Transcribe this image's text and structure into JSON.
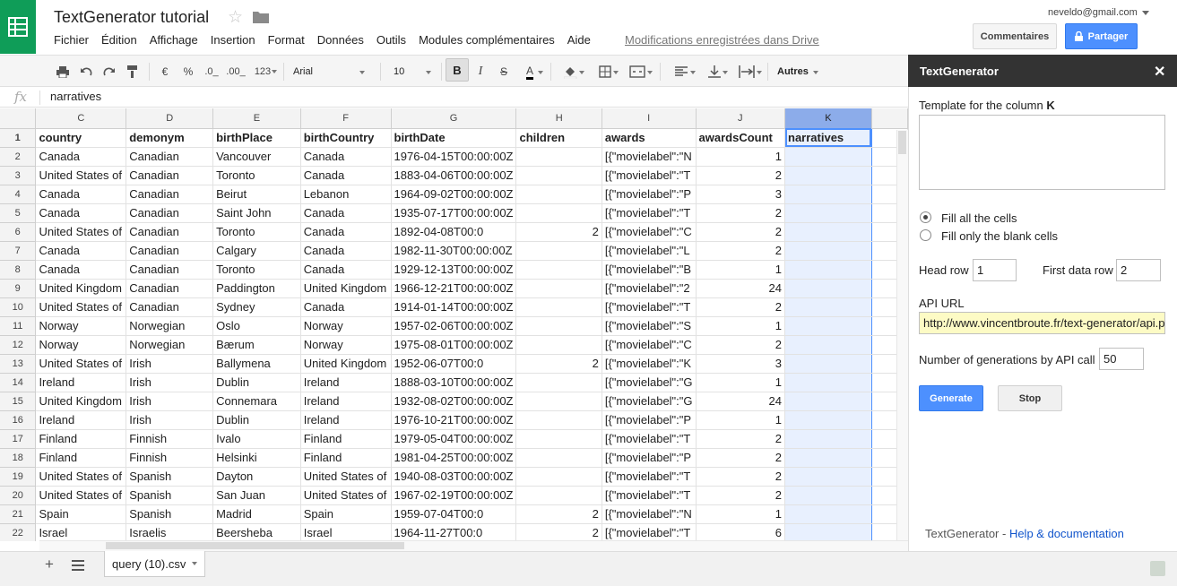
{
  "app": {
    "title": "TextGenerator tutorial",
    "menu": [
      "Fichier",
      "Édition",
      "Affichage",
      "Insertion",
      "Format",
      "Données",
      "Outils",
      "Modules complémentaires",
      "Aide"
    ],
    "saved_status": "Modifications enregistrées dans Drive",
    "user_email": "neveldo@gmail.com",
    "comments_label": "Commentaires",
    "share_label": "Partager",
    "brand_color": "#0f9d58",
    "accent_color": "#4d90fe"
  },
  "toolbar": {
    "currency": "€",
    "percent": "%",
    "dec_less": ".0_",
    "dec_more": ".00_",
    "number_format": "123",
    "font": "Arial",
    "font_size": "10",
    "bold": "B",
    "italic": "I",
    "strike": "S",
    "text_color": "A",
    "more": "Autres"
  },
  "formula_bar": {
    "fx": "fx",
    "value": "narratives"
  },
  "grid": {
    "columns": [
      "C",
      "D",
      "E",
      "F",
      "G",
      "H",
      "I",
      "J",
      "K"
    ],
    "rows": [
      {
        "n": "1",
        "cells": [
          "country",
          "demonym",
          "birthPlace",
          "birthCountry",
          "birthDate",
          "children",
          "awards",
          "awardsCount",
          "narratives"
        ]
      },
      {
        "n": "2",
        "cells": [
          "Canada",
          "Canadian",
          "Vancouver",
          "Canada",
          "1976-04-15T00:00:00Z",
          "",
          "[{\"movielabel\":\"N",
          "1",
          ""
        ]
      },
      {
        "n": "3",
        "cells": [
          "United States of",
          "Canadian",
          "Toronto",
          "Canada",
          "1883-04-06T00:00:00Z",
          "",
          "[{\"movielabel\":\"T",
          "2",
          ""
        ]
      },
      {
        "n": "4",
        "cells": [
          "Canada",
          "Canadian",
          "Beirut",
          "Lebanon",
          "1964-09-02T00:00:00Z",
          "",
          "[{\"movielabel\":\"P",
          "3",
          ""
        ]
      },
      {
        "n": "5",
        "cells": [
          "Canada",
          "Canadian",
          "Saint John",
          "Canada",
          "1935-07-17T00:00:00Z",
          "",
          "[{\"movielabel\":\"T",
          "2",
          ""
        ]
      },
      {
        "n": "6",
        "cells": [
          "United States of",
          "Canadian",
          "Toronto",
          "Canada",
          "1892-04-08T00:0",
          "2",
          "[{\"movielabel\":\"C",
          "2",
          ""
        ]
      },
      {
        "n": "7",
        "cells": [
          "Canada",
          "Canadian",
          "Calgary",
          "Canada",
          "1982-11-30T00:00:00Z",
          "",
          "[{\"movielabel\":\"L",
          "2",
          ""
        ]
      },
      {
        "n": "8",
        "cells": [
          "Canada",
          "Canadian",
          "Toronto",
          "Canada",
          "1929-12-13T00:00:00Z",
          "",
          "[{\"movielabel\":\"B",
          "1",
          ""
        ]
      },
      {
        "n": "9",
        "cells": [
          "United Kingdom",
          "Canadian",
          "Paddington",
          "United Kingdom",
          "1966-12-21T00:00:00Z",
          "",
          "[{\"movielabel\":\"2",
          "24",
          ""
        ]
      },
      {
        "n": "10",
        "cells": [
          "United States of",
          "Canadian",
          "Sydney",
          "Canada",
          "1914-01-14T00:00:00Z",
          "",
          "[{\"movielabel\":\"T",
          "2",
          ""
        ]
      },
      {
        "n": "11",
        "cells": [
          "Norway",
          "Norwegian",
          "Oslo",
          "Norway",
          "1957-02-06T00:00:00Z",
          "",
          "[{\"movielabel\":\"S",
          "1",
          ""
        ]
      },
      {
        "n": "12",
        "cells": [
          "Norway",
          "Norwegian",
          "Bærum",
          "Norway",
          "1975-08-01T00:00:00Z",
          "",
          "[{\"movielabel\":\"C",
          "2",
          ""
        ]
      },
      {
        "n": "13",
        "cells": [
          "United States of",
          "Irish",
          "Ballymena",
          "United Kingdom",
          "1952-06-07T00:0",
          "2",
          "[{\"movielabel\":\"K",
          "3",
          ""
        ]
      },
      {
        "n": "14",
        "cells": [
          "Ireland",
          "Irish",
          "Dublin",
          "Ireland",
          "1888-03-10T00:00:00Z",
          "",
          "[{\"movielabel\":\"G",
          "1",
          ""
        ]
      },
      {
        "n": "15",
        "cells": [
          "United Kingdom",
          "Irish",
          "Connemara",
          "Ireland",
          "1932-08-02T00:00:00Z",
          "",
          "[{\"movielabel\":\"G",
          "24",
          ""
        ]
      },
      {
        "n": "16",
        "cells": [
          "Ireland",
          "Irish",
          "Dublin",
          "Ireland",
          "1976-10-21T00:00:00Z",
          "",
          "[{\"movielabel\":\"P",
          "1",
          ""
        ]
      },
      {
        "n": "17",
        "cells": [
          "Finland",
          "Finnish",
          "Ivalo",
          "Finland",
          "1979-05-04T00:00:00Z",
          "",
          "[{\"movielabel\":\"T",
          "2",
          ""
        ]
      },
      {
        "n": "18",
        "cells": [
          "Finland",
          "Finnish",
          "Helsinki",
          "Finland",
          "1981-04-25T00:00:00Z",
          "",
          "[{\"movielabel\":\"P",
          "2",
          ""
        ]
      },
      {
        "n": "19",
        "cells": [
          "United States of",
          "Spanish",
          "Dayton",
          "United States of",
          "1940-08-03T00:00:00Z",
          "",
          "[{\"movielabel\":\"T",
          "2",
          ""
        ]
      },
      {
        "n": "20",
        "cells": [
          "United States of",
          "Spanish",
          "San Juan",
          "United States of",
          "1967-02-19T00:00:00Z",
          "",
          "[{\"movielabel\":\"T",
          "2",
          ""
        ]
      },
      {
        "n": "21",
        "cells": [
          "Spain",
          "Spanish",
          "Madrid",
          "Spain",
          "1959-07-04T00:0",
          "2",
          "[{\"movielabel\":\"N",
          "1",
          ""
        ]
      },
      {
        "n": "22",
        "cells": [
          "Israel",
          "Israelis",
          "Beersheba",
          "Israel",
          "1964-11-27T00:0",
          "2",
          "[{\"movielabel\":\"T",
          "6",
          ""
        ]
      }
    ]
  },
  "sheet": {
    "add": "+",
    "tab_name": "query (10).csv"
  },
  "sidebar": {
    "title": "TextGenerator",
    "close": "✕",
    "template_label": "Template for the column ",
    "template_column": "K",
    "template_value": "",
    "fill_all": "Fill all the cells",
    "fill_blank": "Fill only the blank cells",
    "fill_mode": "all",
    "head_row_label": "Head row",
    "head_row_value": "1",
    "first_data_row_label": "First data row",
    "first_data_row_value": "2",
    "api_url_label": "API URL",
    "api_url_value": "http://www.vincentbroute.fr/text-generator/api.p",
    "generations_label": "Number of generations by API call",
    "generations_value": "50",
    "generate_label": "Generate",
    "stop_label": "Stop",
    "footer_name": "TextGenerator - ",
    "footer_link": "Help & documentation"
  }
}
